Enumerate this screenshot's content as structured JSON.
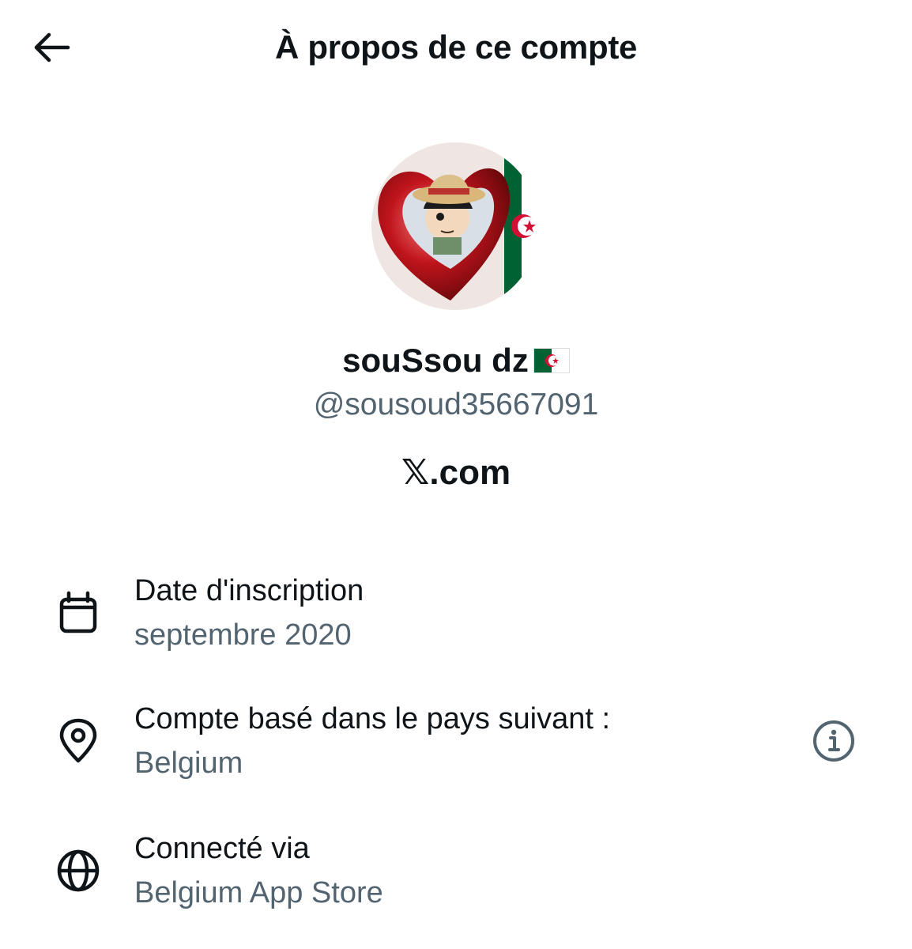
{
  "header": {
    "title": "À propos de ce compte",
    "back_icon": "arrow-left-icon"
  },
  "profile": {
    "display_name": "souSsou dz",
    "flag_emoji": "algeria-flag",
    "handle": "@sousoud35667091",
    "site": "𝕏.com"
  },
  "details": {
    "joined": {
      "icon": "calendar-icon",
      "label": "Date d'inscription",
      "value": "septembre 2020"
    },
    "location": {
      "icon": "location-pin-icon",
      "label": "Compte basé dans le pays suivant :",
      "value": "Belgium",
      "info_icon": "info-icon"
    },
    "connected": {
      "icon": "globe-icon",
      "label": "Connecté via",
      "value": "Belgium App Store"
    }
  },
  "colors": {
    "text_primary": "#0f1419",
    "text_secondary": "#536471",
    "flag_green": "#006233",
    "flag_red": "#d21034"
  }
}
